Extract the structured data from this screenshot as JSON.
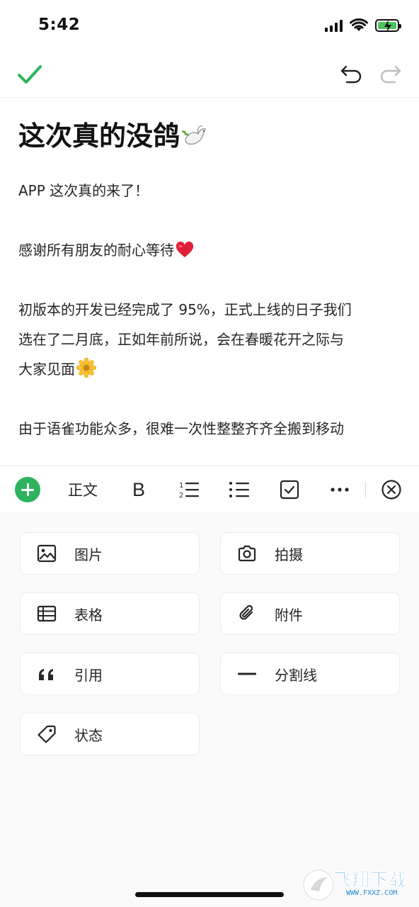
{
  "status_bar": {
    "time": "5:42"
  },
  "document": {
    "title": "这次真的没鸽",
    "paragraphs": {
      "p1": "APP 这次真的来了！",
      "p2": "感谢所有朋友的耐心等待",
      "p3_l1": "初版本的开发已经完成了 95%，正式上线的日子我们",
      "p3_l2": "选在了二月底，正如年前所说，会在春暖花开之际与",
      "p3_l3": "大家见面",
      "p4": "由于语雀功能众多，很难一次性整整齐齐全搬到移动"
    }
  },
  "toolbar": {
    "paragraph_style": "正文",
    "bold": "B"
  },
  "insert_panel": {
    "image": "图片",
    "camera": "拍摄",
    "table": "表格",
    "attachment": "附件",
    "quote": "引用",
    "divider": "分割线",
    "status": "状态"
  },
  "watermark": {
    "text": "飞翔下载",
    "url": "WWW.FXXZ.COM"
  },
  "colors": {
    "accent_green": "#2db35d",
    "heart": "#e0203a",
    "flower": "#f7c32e"
  }
}
